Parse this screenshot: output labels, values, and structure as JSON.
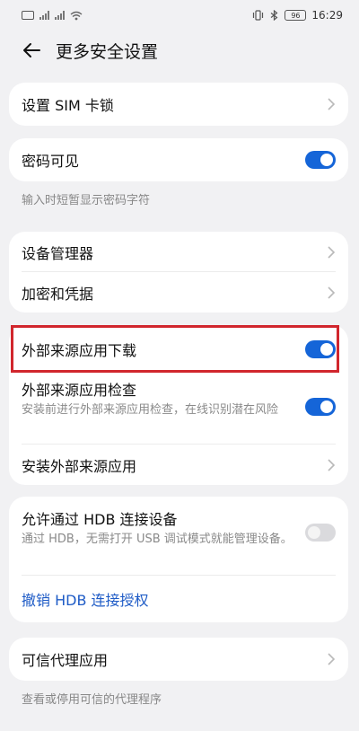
{
  "status_bar": {
    "time": "16:29",
    "battery": "96"
  },
  "header": {
    "title": "更多安全设置"
  },
  "sim_lock": {
    "label": "设置 SIM 卡锁"
  },
  "password_visible": {
    "label": "密码可见",
    "enabled": true,
    "note": "输入时短暂显示密码字符"
  },
  "device_manager": {
    "label": "设备管理器"
  },
  "encryption": {
    "label": "加密和凭据"
  },
  "external_download": {
    "label": "外部来源应用下载",
    "enabled": true
  },
  "external_check": {
    "label": "外部来源应用检查",
    "desc": "安装前进行外部来源应用检查，在线识别潜在风险",
    "enabled": true
  },
  "install_external": {
    "label": "安装外部来源应用"
  },
  "hdb": {
    "label": "允许通过 HDB 连接设备",
    "desc": "通过 HDB，无需打开 USB 调试模式就能管理设备。",
    "enabled": false,
    "revoke_label": "撤销 HDB 连接授权"
  },
  "trust_agents": {
    "label": "可信代理应用",
    "note": "查看或停用可信的代理程序"
  },
  "colors": {
    "accent": "#1565d8",
    "link": "#1e5bc6",
    "highlight": "#d1262d"
  }
}
